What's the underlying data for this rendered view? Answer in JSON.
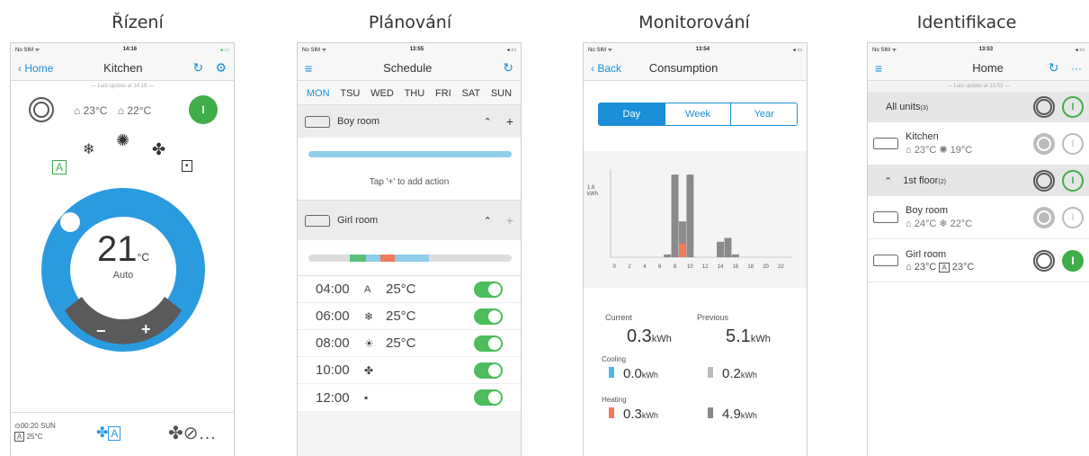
{
  "captions": [
    "Řízení",
    "Plánování",
    "Monitorování",
    "Identifikace"
  ],
  "control": {
    "status_left": "No SIM ᯤ",
    "status_time": "14:16",
    "status_right": "◂ ▭",
    "back": "Home",
    "title": "Kitchen",
    "last_update": "— Last update at 14:16 —",
    "indoor_temp": "23°C",
    "outdoor_temp": "22°C",
    "set_temp": "21",
    "unit": "°C",
    "mode": "Auto",
    "minus": "−",
    "plus": "+",
    "timer": "00:20 SUN",
    "timer_temp": "25°C",
    "power_on": "I"
  },
  "schedule": {
    "status_left": "No SIM ᯤ",
    "status_time": "13:55",
    "status_right": "◂ ▭",
    "title": "Schedule",
    "days": [
      "MON",
      "TSU",
      "WED",
      "THU",
      "FRI",
      "SAT",
      "SUN"
    ],
    "active_day": "MON",
    "room1": "Boy room",
    "hint": "Tap '+' to add action",
    "room2": "Girl room",
    "actions": [
      {
        "time": "04:00",
        "icon": "A",
        "temp": "25°C"
      },
      {
        "time": "06:00",
        "icon": "❄",
        "temp": "25°C"
      },
      {
        "time": "08:00",
        "icon": "☀",
        "temp": "25°C"
      },
      {
        "time": "10:00",
        "icon": "✤",
        "temp": ""
      },
      {
        "time": "12:00",
        "icon": "▪",
        "temp": ""
      }
    ]
  },
  "monitor": {
    "status_left": "No SIM ᯤ",
    "status_time": "13:54",
    "status_right": "◂ ▭",
    "back": "Back",
    "title": "Consumption",
    "tabs": [
      "Day",
      "Week",
      "Year"
    ],
    "active_tab": "Day",
    "y_label": "1.6",
    "y_unit": "kWh",
    "current_label": "Current",
    "previous_label": "Previous",
    "current": "0.3",
    "previous": "5.1",
    "kwh": "kWh",
    "cooling_label": "Cooling",
    "cool_current": "0.0",
    "cool_previous": "0.2",
    "heating_label": "Heating",
    "heat_current": "0.3",
    "heat_previous": "4.9"
  },
  "chart_data": {
    "type": "bar",
    "categories": [
      "0",
      "1",
      "2",
      "3",
      "4",
      "5",
      "6",
      "7",
      "8",
      "9",
      "10",
      "11",
      "12",
      "13",
      "14",
      "15",
      "16",
      "17",
      "18",
      "19",
      "20",
      "21",
      "22",
      "23"
    ],
    "x_ticks": [
      "0",
      "2",
      "4",
      "6",
      "8",
      "10",
      "12",
      "14",
      "16",
      "18",
      "20",
      "22"
    ],
    "series": [
      {
        "name": "Previous",
        "values": [
          0,
          0,
          0,
          0,
          0,
          0,
          0,
          0.05,
          1.5,
          0.65,
          1.5,
          0,
          0,
          0,
          0.28,
          0.35,
          0.05,
          0,
          0,
          0,
          0,
          0,
          0,
          0
        ]
      },
      {
        "name": "Current",
        "values": [
          0,
          0,
          0,
          0,
          0,
          0,
          0,
          0,
          0,
          0.25,
          0,
          0,
          0,
          0,
          0,
          0,
          0,
          0,
          0,
          0,
          0,
          0,
          0,
          0
        ]
      }
    ],
    "ylim": [
      0,
      1.6
    ],
    "colors": {
      "previous": "#8a8a8a",
      "current": "#f07a5a"
    }
  },
  "home": {
    "status_left": "No SIM ᯤ",
    "status_time": "13:53",
    "status_right": "◂ ▭",
    "title": "Home",
    "more": "···",
    "last_update": "— Last update at 13:53 —",
    "all_units": "All units",
    "all_units_count": "(3)",
    "floor": "1st floor",
    "floor_count": "(2)",
    "kitchen": "Kitchen",
    "kitchen_in": "23°C",
    "kitchen_set": "19°C",
    "boy": "Boy room",
    "boy_in": "24°C",
    "boy_set": "22°C",
    "girl": "Girl room",
    "girl_in": "23°C",
    "girl_set": "23°C",
    "power_on": "I"
  }
}
